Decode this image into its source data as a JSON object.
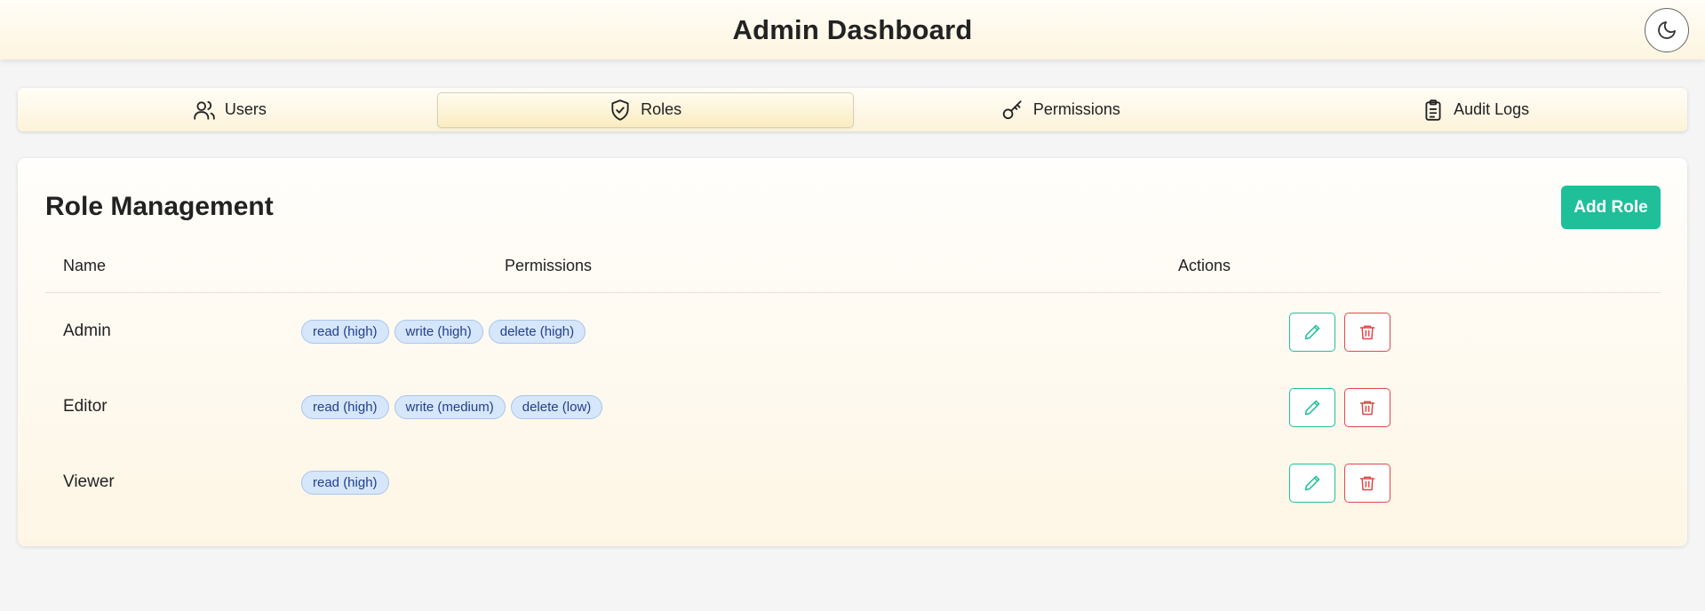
{
  "header": {
    "title": "Admin Dashboard",
    "theme_icon": "moon-icon"
  },
  "tabs": [
    {
      "label": "Users",
      "icon": "users-icon",
      "active": false
    },
    {
      "label": "Roles",
      "icon": "shield-check-icon",
      "active": true
    },
    {
      "label": "Permissions",
      "icon": "key-icon",
      "active": false
    },
    {
      "label": "Audit Logs",
      "icon": "clipboard-list-icon",
      "active": false
    }
  ],
  "main": {
    "title": "Role Management",
    "add_button": "Add Role",
    "columns": [
      "Name",
      "Permissions",
      "Actions"
    ],
    "rows": [
      {
        "name": "Admin",
        "permissions": [
          "read (high)",
          "write (high)",
          "delete (high)"
        ]
      },
      {
        "name": "Editor",
        "permissions": [
          "read (high)",
          "write (medium)",
          "delete (low)"
        ]
      },
      {
        "name": "Viewer",
        "permissions": [
          "read (high)"
        ]
      }
    ]
  },
  "colors": {
    "accent": "#1fbf9a",
    "danger": "#e04848",
    "tag_bg": "#d6e6fb",
    "tag_text": "#23418a"
  }
}
